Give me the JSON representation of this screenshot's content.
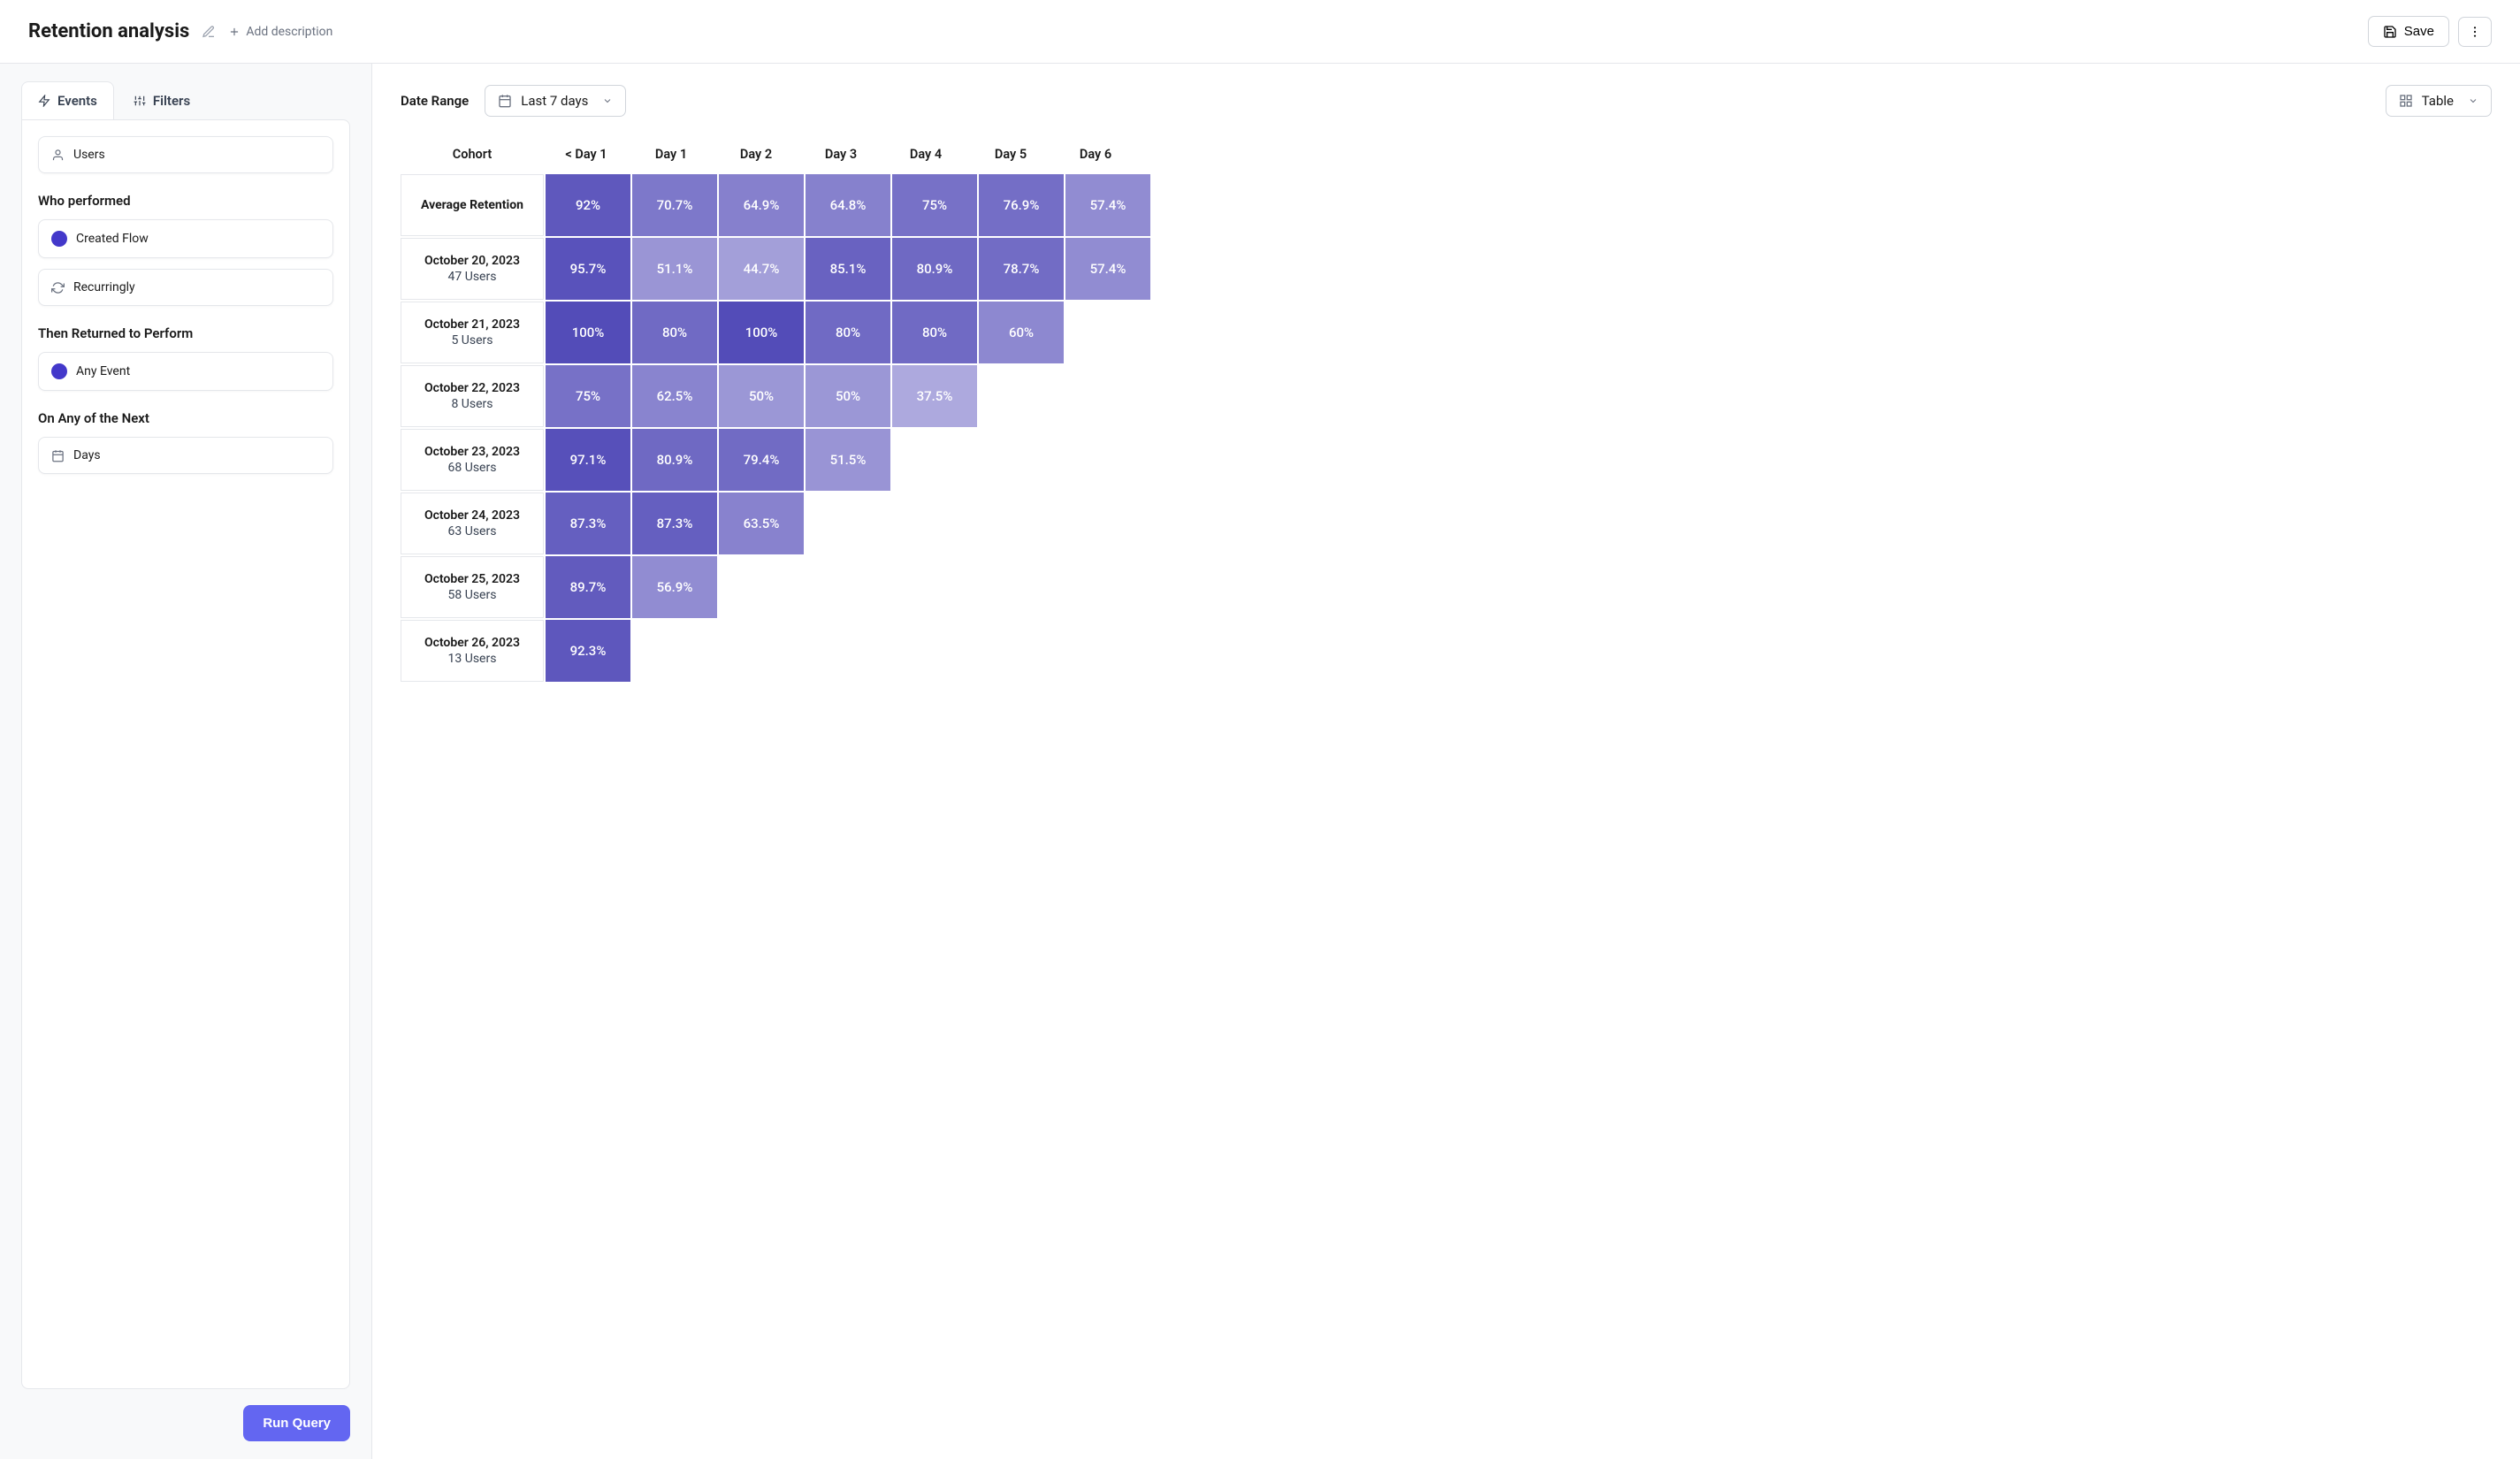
{
  "header": {
    "title": "Retention analysis",
    "add_description": "Add description",
    "save": "Save"
  },
  "sidebar": {
    "tabs": {
      "events": "Events",
      "filters": "Filters"
    },
    "users_label": "Users",
    "who_performed_label": "Who performed",
    "created_flow": "Created Flow",
    "recurringly": "Recurringly",
    "then_returned_label": "Then Returned to Perform",
    "any_event": "Any Event",
    "on_any_label": "On Any of the Next",
    "days": "Days",
    "run_query": "Run Query"
  },
  "controls": {
    "date_range_label": "Date Range",
    "date_range_value": "Last 7 days",
    "view_value": "Table"
  },
  "chart_data": {
    "type": "heatmap",
    "title": "Retention analysis",
    "columns": [
      "Cohort",
      "< Day 1",
      "Day 1",
      "Day 2",
      "Day 3",
      "Day 4",
      "Day 5",
      "Day 6"
    ],
    "average_label": "Average Retention",
    "average": [
      92,
      70.7,
      64.9,
      64.8,
      75,
      76.9,
      57.4
    ],
    "rows": [
      {
        "date": "October 20, 2023",
        "users": "47 Users",
        "values": [
          95.7,
          51.1,
          44.7,
          85.1,
          80.9,
          78.7,
          57.4
        ]
      },
      {
        "date": "October 21, 2023",
        "users": "5 Users",
        "values": [
          100,
          80,
          100,
          80,
          80,
          60
        ]
      },
      {
        "date": "October 22, 2023",
        "users": "8 Users",
        "values": [
          75,
          62.5,
          50,
          50,
          37.5
        ]
      },
      {
        "date": "October 23, 2023",
        "users": "68 Users",
        "values": [
          97.1,
          80.9,
          79.4,
          51.5
        ]
      },
      {
        "date": "October 24, 2023",
        "users": "63 Users",
        "values": [
          87.3,
          87.3,
          63.5
        ]
      },
      {
        "date": "October 25, 2023",
        "users": "58 Users",
        "values": [
          89.7,
          56.9
        ]
      },
      {
        "date": "October 26, 2023",
        "users": "13 Users",
        "values": [
          92.3
        ]
      }
    ],
    "color_scale": {
      "low": "#b1addf",
      "high": "#534cb8"
    }
  }
}
